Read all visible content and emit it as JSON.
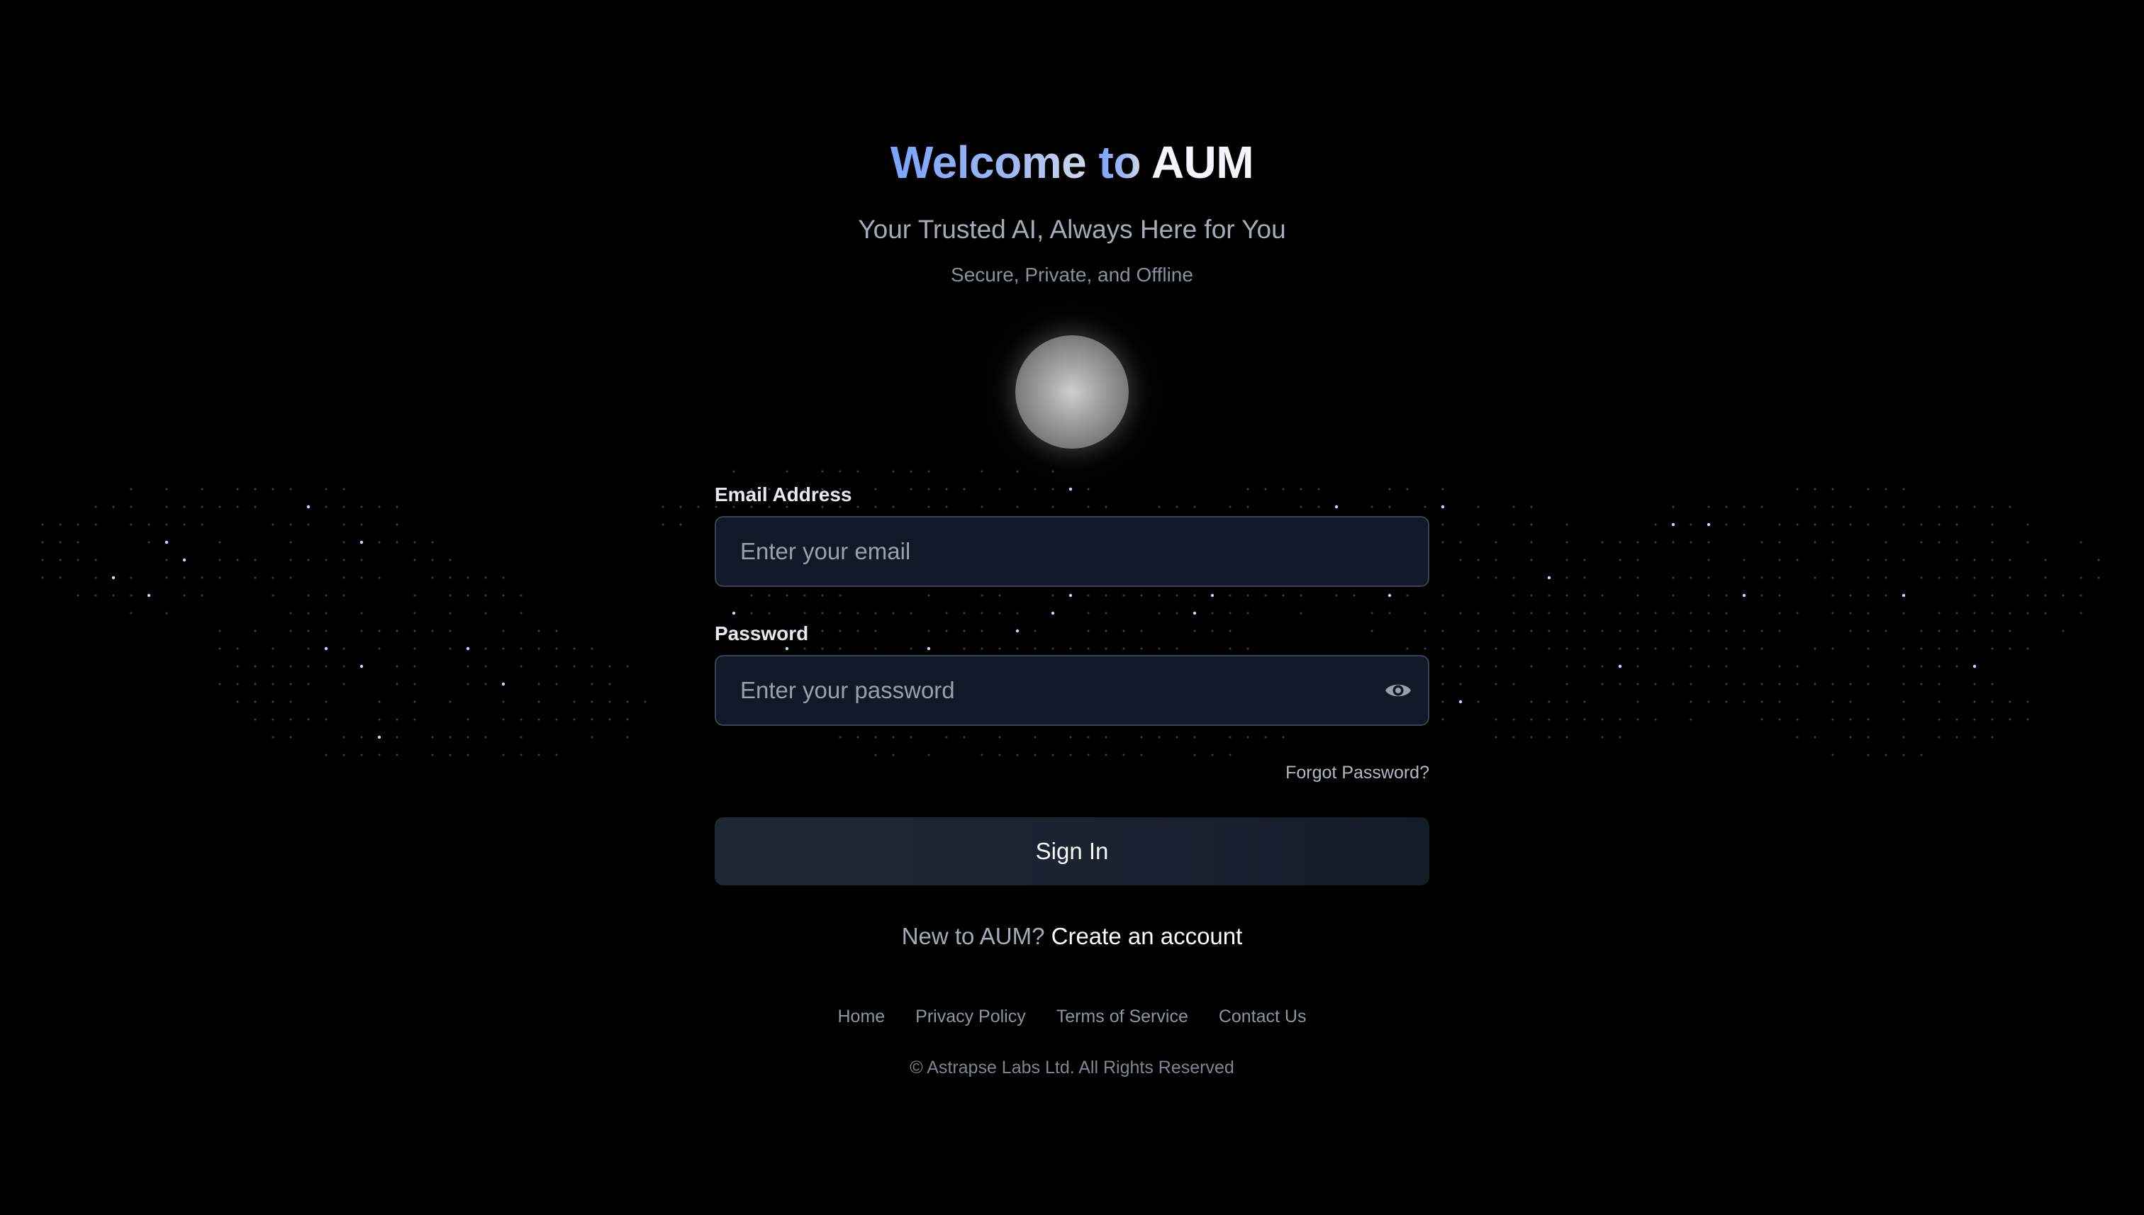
{
  "header": {
    "title_highlight": "Welcome",
    "title_rest": "to AUM",
    "subtitle": "Your Trusted AI, Always Here for You",
    "tagline": "Secure, Private, and Offline"
  },
  "colors": {
    "background": "#000000",
    "title_gradient_start": "#7aa4ff",
    "field_background": "#111827",
    "button_background": "#1f2733"
  },
  "form": {
    "email": {
      "label": "Email Address",
      "placeholder": "Enter your email",
      "value": ""
    },
    "password": {
      "label": "Password",
      "placeholder": "Enter your password",
      "value": "",
      "toggle_icon": "eye-icon"
    },
    "forgot_password": "Forgot Password?",
    "submit_label": "Sign In",
    "signup_prompt": "New to AUM?",
    "signup_link": "Create an account"
  },
  "footer": {
    "links": [
      "Home",
      "Privacy Policy",
      "Terms of Service",
      "Contact Us"
    ],
    "copyright": "© Astrapse Labs Ltd. All Rights Reserved"
  }
}
